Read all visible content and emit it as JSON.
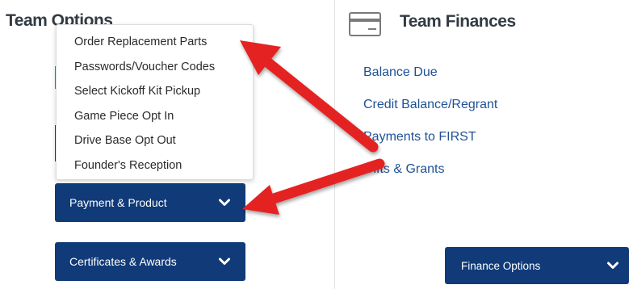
{
  "team_options": {
    "title": "Team Options",
    "dropdown_items": [
      "Order Replacement Parts",
      "Passwords/Voucher Codes",
      "Select Kickoff Kit Pickup",
      "Game Piece Opt In",
      "Drive Base Opt Out",
      "Founder's Reception"
    ],
    "payment_button": "Payment & Product",
    "certificates_button": "Certificates & Awards"
  },
  "team_finances": {
    "title": "Team Finances",
    "links": [
      "Balance Due",
      "Credit Balance/Regrant",
      "Payments to FIRST",
      "Gifts & Grants"
    ],
    "finance_options_button": "Finance Options"
  },
  "icons": {
    "finances": "credit-card-icon",
    "chevron": "chevron-down-icon",
    "annotation": "red-arrow"
  },
  "colors": {
    "button_bg": "#103a78",
    "link": "#1f5196",
    "arrow": "#e52320"
  }
}
